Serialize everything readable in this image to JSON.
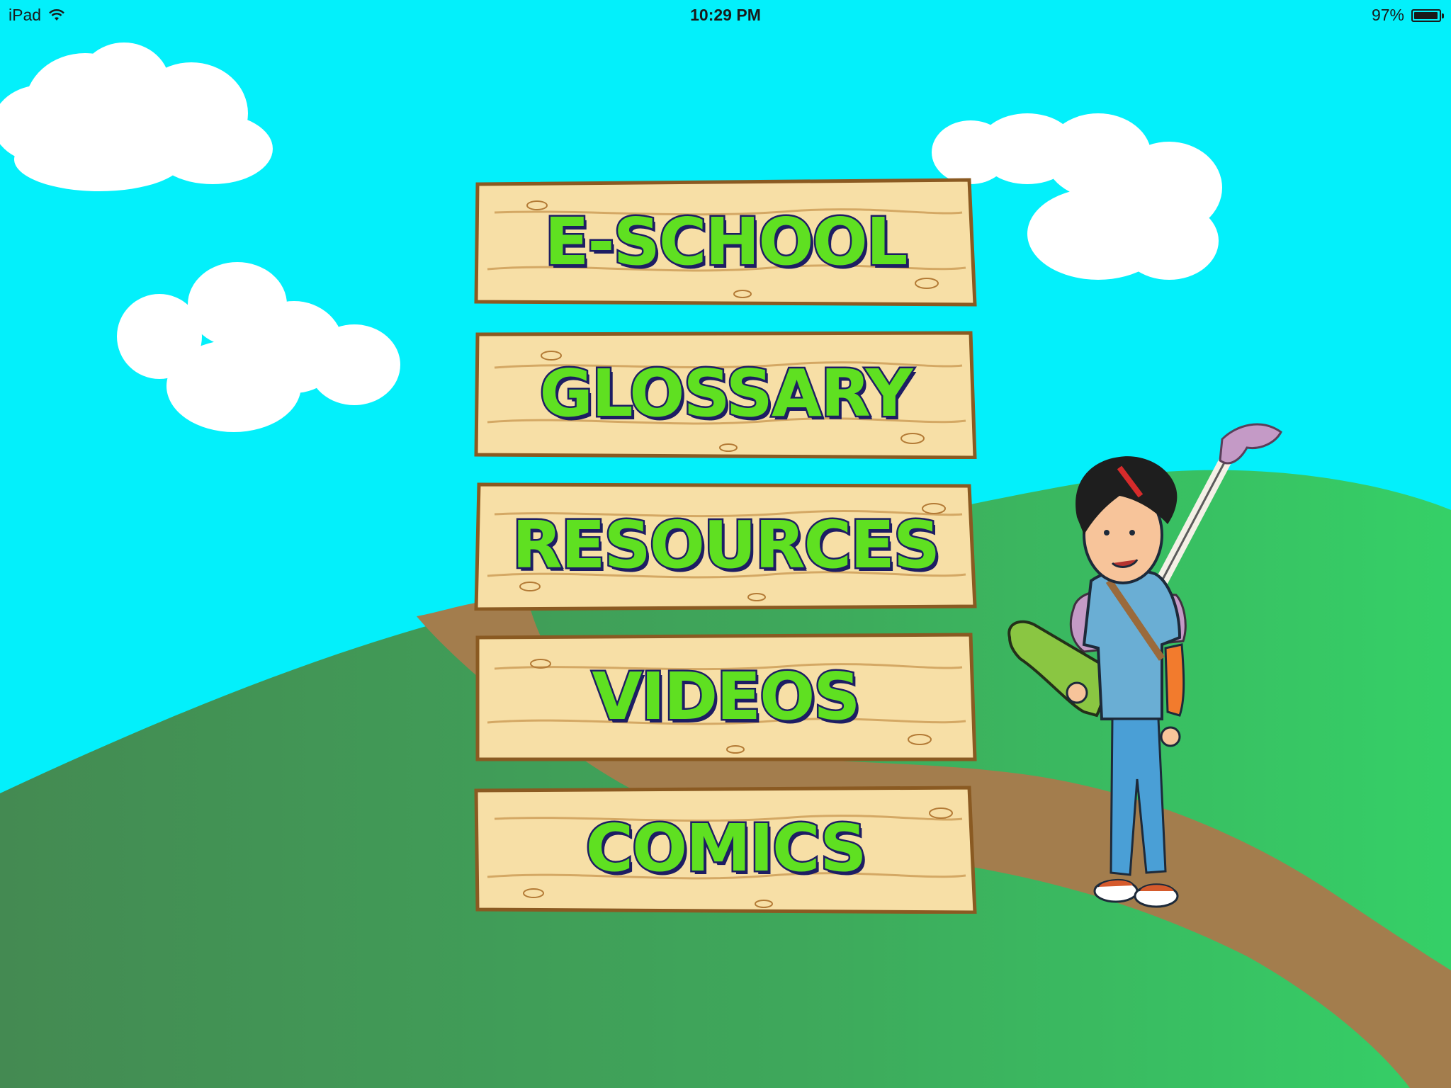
{
  "status_bar": {
    "device": "iPad",
    "time": "10:29 PM",
    "battery_percent": "97%",
    "battery_level": 0.97
  },
  "menu": {
    "items": [
      {
        "label": "E-SCHOOL"
      },
      {
        "label": "GLOSSARY"
      },
      {
        "label": "RESOURCES"
      },
      {
        "label": "VIDEOS"
      },
      {
        "label": "COMICS"
      }
    ]
  },
  "colors": {
    "sky": "#03f0fb",
    "hill_dark": "#3f8f4f",
    "hill_light": "#37c765",
    "path": "#a37d4d",
    "label_fill": "#5fe021",
    "label_outline": "#1d1d63",
    "wood": "#f7dfa6"
  }
}
